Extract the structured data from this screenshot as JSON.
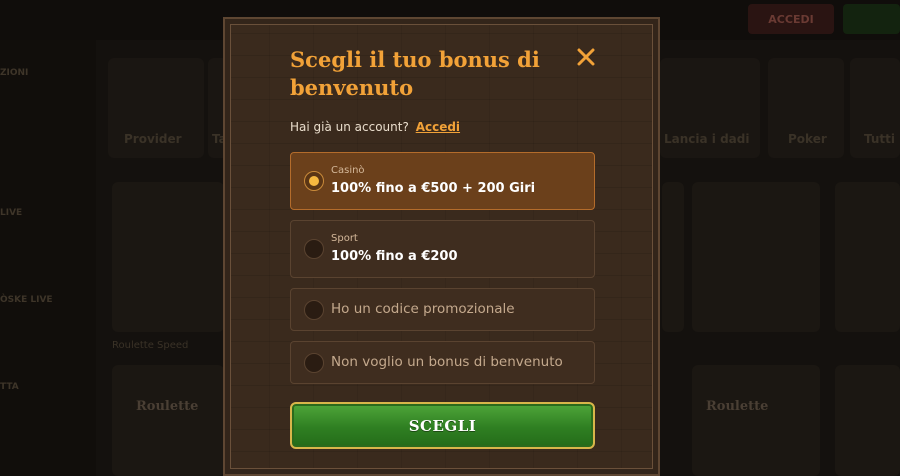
{
  "background": {
    "header_login_label": "ACCEDI",
    "sidebar_items": [
      "ZIONI",
      "LIVE",
      "ÒSKE LIVE",
      "TTA"
    ],
    "category_labels": [
      "Provider",
      "Tavoli",
      "Lancia i dadi",
      "Poker",
      "Tutti"
    ],
    "card_labels": [
      "Roulette Speed",
      "Roulette"
    ]
  },
  "modal": {
    "title": "Scegli il tuo bonus di benvenuto",
    "login_prompt": "Hai già un account?",
    "login_link": "Accedi",
    "options": [
      {
        "category": "Casinò",
        "label": "100% fino a €500 + 200 Giri",
        "selected": true
      },
      {
        "category": "Sport",
        "label": "100% fino a €200",
        "selected": false
      },
      {
        "label": "Ho un codice promozionale",
        "selected": false
      },
      {
        "label": "Non voglio un bonus di benvenuto",
        "selected": false
      }
    ],
    "submit_label": "SCEGLI",
    "icons": {
      "close": "close-icon"
    }
  },
  "colors": {
    "accent": "#f2a238",
    "selected_option": "#6b401b",
    "cta_green": "#2f7f22",
    "cta_border": "#d8b64a"
  }
}
